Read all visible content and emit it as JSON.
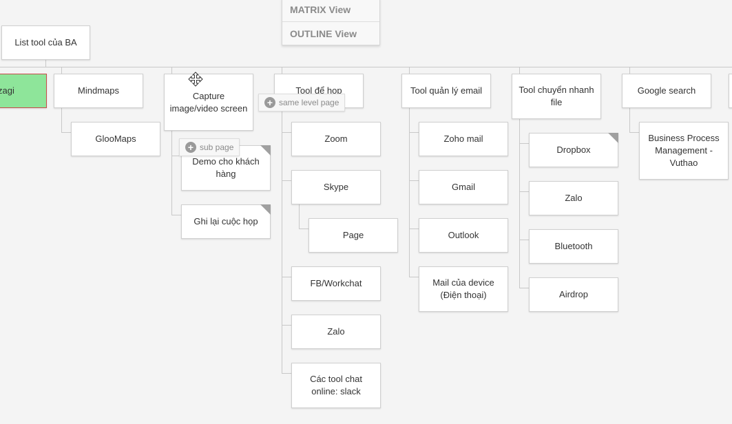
{
  "view_menu": {
    "matrix": "MATRIX View",
    "outline": "OUTLINE View"
  },
  "root": {
    "label": "List tool của BA"
  },
  "branches": {
    "zagi": "zagi",
    "mindmaps": {
      "label": "Mindmaps",
      "children": [
        "GlooMaps"
      ]
    },
    "capture": {
      "label": "Capture image/video screen",
      "children": [
        "Demo cho khách hàng",
        "Ghi lại cuộc họp"
      ]
    },
    "meeting": {
      "label": "Tool để họp",
      "children": [
        "Zoom",
        "Skype",
        "Page",
        "FB/Workchat",
        "Zalo",
        "Các tool chat online: slack"
      ]
    },
    "email": {
      "label": "Tool quản lý email",
      "children": [
        "Zoho mail",
        "Gmail",
        "Outlook",
        "Mail của device (Điện thoại)"
      ]
    },
    "transfer": {
      "label": "Tool chuyển nhanh file",
      "children": [
        "Dropbox",
        "Zalo",
        "Bluetooth",
        "Airdrop"
      ]
    },
    "google": {
      "label": "Google search",
      "children": [
        "Business Process Management - Vuthao"
      ]
    }
  },
  "popups": {
    "same_level": "same level page",
    "sub_page": "sub page",
    "plus_icon": "+"
  },
  "icons": {
    "move_cursor": "move-cursor-icon"
  }
}
